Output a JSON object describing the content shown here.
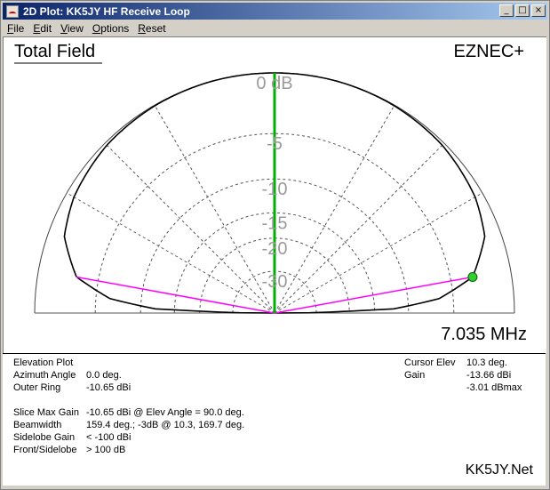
{
  "window": {
    "title": "2D Plot: KK5JY HF Receive Loop",
    "buttons": {
      "minimize": "_",
      "maximize": "□",
      "close": "×"
    }
  },
  "menu": [
    {
      "label": "File",
      "accel": "F"
    },
    {
      "label": "Edit",
      "accel": "E"
    },
    {
      "label": "View",
      "accel": "V"
    },
    {
      "label": "Options",
      "accel": "O"
    },
    {
      "label": "Reset",
      "accel": "R"
    }
  ],
  "plot": {
    "heading": "Total Field",
    "product": "EZNEC+",
    "frequency": "7.035 MHz",
    "ring_labels": [
      "0 dB",
      "-5",
      "-10",
      "-15",
      "-20",
      "-30"
    ],
    "colors": {
      "pattern": "#000000",
      "slice": "#ff00ff",
      "axis": "#00b000",
      "cursor": "#33cc33",
      "grid": "#555555"
    }
  },
  "chart_data": {
    "type": "polar-elevation",
    "ring_db": [
      0,
      -5,
      -10,
      -15,
      -20,
      -30
    ],
    "elev_deg": [
      0,
      2,
      5,
      10.3,
      20,
      30,
      45,
      60,
      75,
      90,
      105,
      120,
      135,
      150,
      160,
      169.7,
      175,
      178,
      180
    ],
    "rel_db": [
      -40,
      -12,
      -6.4,
      -3.01,
      -1.2,
      -0.6,
      -0.2,
      -0.05,
      0,
      0,
      0,
      -0.05,
      -0.2,
      -0.6,
      -1.2,
      -3.01,
      -6.4,
      -12,
      -40
    ],
    "cursor_elev_deg": 10.3
  },
  "info": {
    "left": [
      {
        "label": "Elevation Plot",
        "value": ""
      },
      {
        "label": "Azimuth Angle",
        "value": "0.0 deg."
      },
      {
        "label": "Outer Ring",
        "value": "-10.65 dBi"
      },
      {
        "label": "Slice Max Gain",
        "value": "-10.65 dBi @ Elev Angle = 90.0 deg."
      },
      {
        "label": "Beamwidth",
        "value": "159.4 deg.; -3dB @ 10.3, 169.7 deg."
      },
      {
        "label": "Sidelobe Gain",
        "value": "< -100 dBi"
      },
      {
        "label": "Front/Sidelobe",
        "value": "> 100 dB"
      }
    ],
    "right": [
      {
        "label": "Cursor Elev",
        "value": "10.3 deg."
      },
      {
        "label": "Gain",
        "value": "-13.66 dBi"
      },
      {
        "label": "",
        "value": "-3.01 dBmax"
      }
    ],
    "branding": "KK5JY.Net"
  }
}
